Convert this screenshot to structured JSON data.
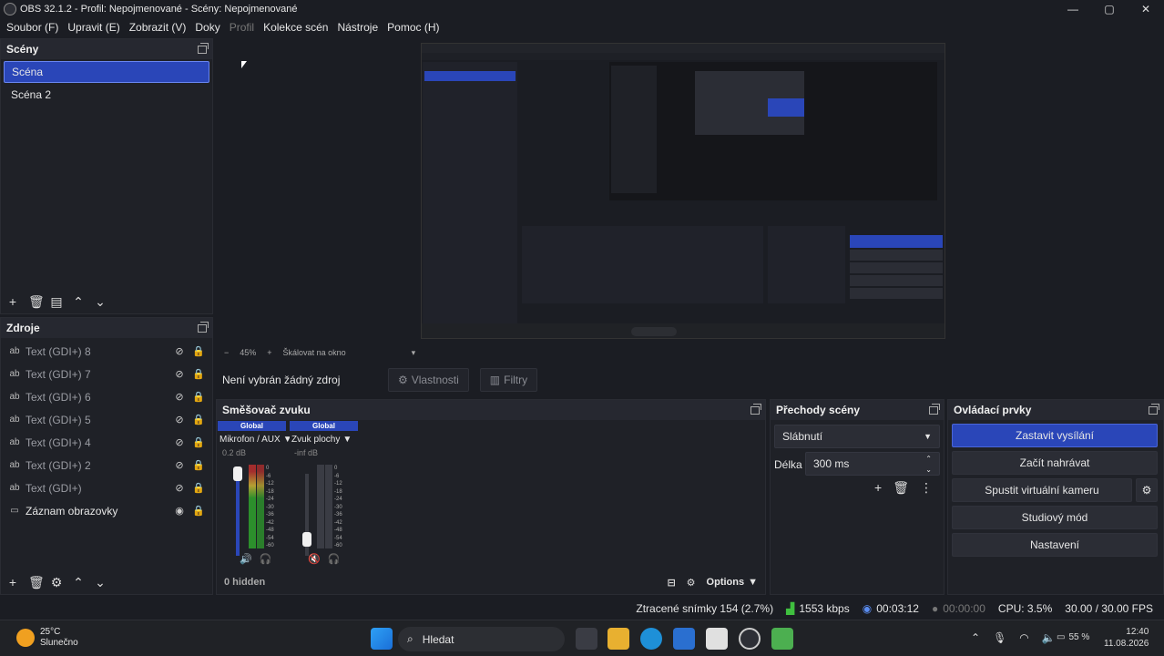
{
  "window": {
    "title": "OBS 32.1.2 - Profil: Nepojmenované - Scény: Nepojmenované",
    "controls": [
      "—",
      "▢",
      "✕"
    ]
  },
  "menu": {
    "items": [
      {
        "label": "Soubor (F)",
        "disabled": false
      },
      {
        "label": "Upravit (E)",
        "disabled": false
      },
      {
        "label": "Zobrazit (V)",
        "disabled": false
      },
      {
        "label": "Doky",
        "disabled": false
      },
      {
        "label": "Profil",
        "disabled": true
      },
      {
        "label": "Kolekce scén",
        "disabled": false
      },
      {
        "label": "Nástroje",
        "disabled": false
      },
      {
        "label": "Pomoc (H)",
        "disabled": false
      }
    ]
  },
  "scenes": {
    "title": "Scény",
    "items": [
      "Scéna",
      "Scéna 2"
    ],
    "selected": 0
  },
  "sources": {
    "title": "Zdroje",
    "items": [
      {
        "label": "Text (GDI+) 8",
        "visible": false
      },
      {
        "label": "Text (GDI+) 7",
        "visible": false
      },
      {
        "label": "Text (GDI+) 6",
        "visible": false
      },
      {
        "label": "Text (GDI+) 5",
        "visible": false
      },
      {
        "label": "Text (GDI+) 4",
        "visible": false
      },
      {
        "label": "Text (GDI+) 2",
        "visible": false
      },
      {
        "label": "Text (GDI+)",
        "visible": false
      },
      {
        "label": "Záznam obrazovky",
        "visible": true
      }
    ]
  },
  "preview": {
    "zoom": "45%",
    "scale_label": "Škálovat na okno"
  },
  "props": {
    "no_source": "Není vybrán žádný zdroj",
    "properties": "Vlastnosti",
    "filters": "Filtry"
  },
  "mixer": {
    "title": "Směšovač zvuku",
    "channels": [
      {
        "badge": "Global",
        "name": "Mikrofon / AUX",
        "db": "0.2 dB",
        "level": 0.85
      },
      {
        "badge": "Global",
        "name": "Zvuk plochy",
        "db": "-inf dB",
        "level": 0.0
      }
    ],
    "ticks": [
      "0",
      "-6",
      "-12",
      "-18",
      "-24",
      "-30",
      "-36",
      "-42",
      "-48",
      "-54",
      "-60"
    ],
    "hidden": "0 hidden",
    "options": "Options"
  },
  "transitions": {
    "title": "Přechody scény",
    "selected": "Slábnutí",
    "duration_label": "Délka",
    "duration": "300 ms"
  },
  "controls": {
    "title": "Ovládací prvky",
    "stop_stream": "Zastavit vysílání",
    "start_record": "Začít nahrávat",
    "virtual_cam": "Spustit virtuální kameru",
    "studio_mode": "Studiový mód",
    "settings": "Nastavení"
  },
  "status": {
    "dropped": "Ztracené snímky 154 (2.7%)",
    "bitrate": "1553 kbps",
    "stream_time": "00:03:12",
    "rec_time": "00:00:00",
    "cpu": "CPU: 3.5%",
    "fps": "30.00 / 30.00 FPS"
  },
  "taskbar": {
    "weather_temp": "25°C",
    "weather_desc": "Slunečno",
    "search": "Hledat",
    "battery": "55 %",
    "time": "12:40",
    "date": "11.08.2026"
  },
  "colors": {
    "accent": "#2a46b8",
    "panel": "#1f2127",
    "bg": "#1b1d23"
  }
}
